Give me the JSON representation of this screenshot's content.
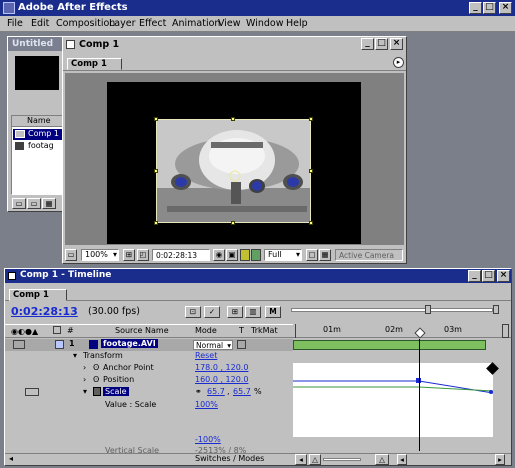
{
  "app": {
    "title": "Adobe After Effects"
  },
  "menu": [
    "File",
    "Edit",
    "Composition",
    "Layer",
    "Effect",
    "Animation",
    "View",
    "Window",
    "Help"
  ],
  "project": {
    "tab_label": "Untitled",
    "name_header": "Name",
    "items": [
      "Comp 1",
      "footag"
    ]
  },
  "comp_window": {
    "title": "Comp 1",
    "tab_label": "Comp 1",
    "zoom": "100%",
    "timecode": "0:02:28:13",
    "resolution": "Full",
    "camera": "Active Camera"
  },
  "timeline": {
    "title": "Comp 1 - Timeline",
    "tab_label": "Comp 1",
    "timecode": "0:02:28:13",
    "fps": "(30.00 fps)",
    "headers": {
      "num": "#",
      "source": "Source Name",
      "mode": "Mode",
      "t": "T",
      "trkmat": "TrkMat"
    },
    "ruler_labels": [
      "01m",
      "02m",
      "03m"
    ],
    "layer": {
      "index": "1",
      "name": "footage.AVI",
      "mode": "Normal"
    },
    "properties": [
      {
        "name": "Transform",
        "value": "Reset"
      },
      {
        "name": "Anchor Point",
        "value": "178.0 , 120.0"
      },
      {
        "name": "Position",
        "value": "160.0 , 120.0"
      },
      {
        "name": "Scale",
        "value_x": "65.7",
        "value_y": "65.7",
        "unit": "%"
      },
      {
        "name": "Value : Scale",
        "value": "100%"
      }
    ],
    "graph_labels": [
      "-100%"
    ],
    "hidden_row": {
      "name": "Vertical Scale",
      "value": "-2513% / 8%"
    },
    "bottom_toggle": "Switches / Modes"
  }
}
